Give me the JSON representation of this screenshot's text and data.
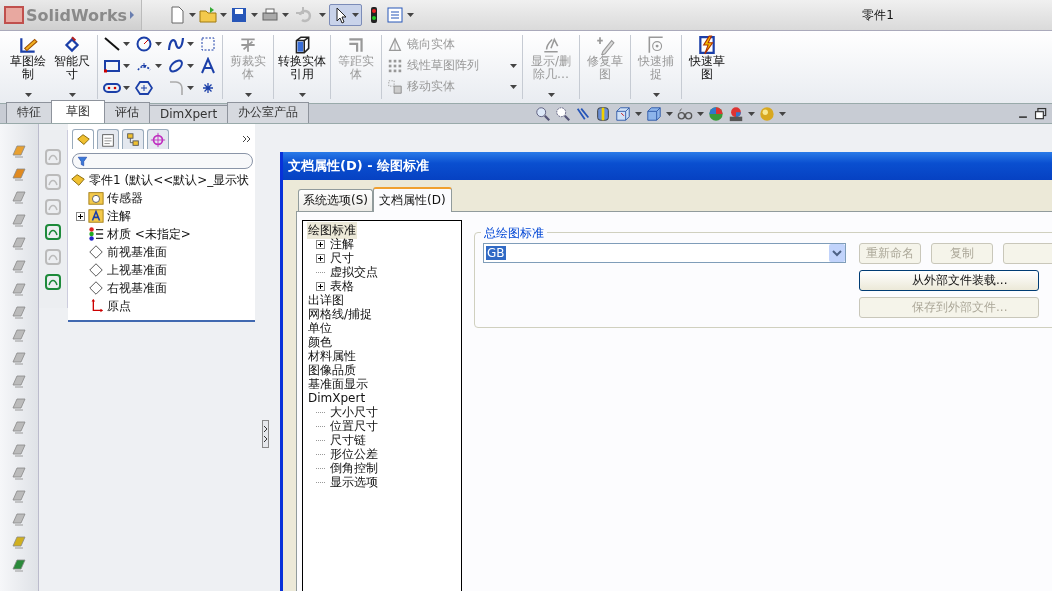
{
  "app": {
    "logo": "SolidWorks",
    "title": "零件1"
  },
  "quick_toolbar": {
    "select_selected": true,
    "undo_disabled": true
  },
  "ribbon": [
    {
      "kind": "large",
      "label": "草图绘制",
      "disabled": false,
      "menu": true
    },
    {
      "kind": "large",
      "label": "智能尺寸",
      "disabled": false,
      "menu": true
    },
    {
      "kind": "tools"
    },
    {
      "kind": "large",
      "label": "剪裁实体",
      "disabled": true,
      "menu": true
    },
    {
      "kind": "large",
      "label": "转换实体引用",
      "disabled": false,
      "menu": true
    },
    {
      "kind": "large",
      "label": "等距实体",
      "disabled": true,
      "menu": false
    },
    {
      "kind": "stack",
      "disabled": true,
      "rows": [
        {
          "label": "镜向实体",
          "menu": false
        },
        {
          "label": "线性草图阵列",
          "menu": true
        },
        {
          "label": "移动实体",
          "menu": true
        }
      ]
    },
    {
      "kind": "large",
      "label": "显示/删除几…",
      "disabled": true,
      "menu": true
    },
    {
      "kind": "large",
      "label": "修复草图",
      "disabled": true,
      "menu": false
    },
    {
      "kind": "large",
      "label": "快速捕捉",
      "disabled": true,
      "menu": true
    },
    {
      "kind": "large",
      "label": "快速草图",
      "disabled": false,
      "menu": false
    }
  ],
  "command_tabs": [
    {
      "label": "特征",
      "selected": false
    },
    {
      "label": "草图",
      "selected": true
    },
    {
      "label": "评估",
      "selected": false
    },
    {
      "label": "DimXpert",
      "selected": false
    },
    {
      "label": "办公室产品",
      "selected": false
    }
  ],
  "feature_tree": {
    "tabs": [
      {
        "selected": true
      },
      {
        "selected": false
      },
      {
        "selected": false
      },
      {
        "selected": false
      }
    ],
    "root": "零件1 (默认<<默认>_显示状",
    "items": [
      {
        "kind": "sensor",
        "label": "传感器"
      },
      {
        "kind": "annotation",
        "label": "注解",
        "expanded": false
      },
      {
        "kind": "material",
        "label": "材质 <未指定>"
      },
      {
        "kind": "plane",
        "label": "前视基准面"
      },
      {
        "kind": "plane",
        "label": "上视基准面"
      },
      {
        "kind": "plane",
        "label": "右视基准面"
      },
      {
        "kind": "origin",
        "label": "原点"
      }
    ]
  },
  "dialog": {
    "title": "文档属性(D) - 绘图标准",
    "tabs": [
      {
        "label": "系统选项(S)",
        "selected": false
      },
      {
        "label": "文档属性(D)",
        "selected": true
      }
    ],
    "tree": [
      {
        "label": "绘图标准",
        "selected": true,
        "children": [
          {
            "label": "注解",
            "selected": false,
            "expanded": false
          },
          {
            "label": "尺寸",
            "selected": false,
            "expanded": false
          },
          {
            "label": "虚拟交点",
            "selected": false
          },
          {
            "label": "表格",
            "selected": false,
            "expanded": false
          }
        ]
      },
      {
        "label": "出详图",
        "selected": false
      },
      {
        "label": "网格线/捕捉",
        "selected": false
      },
      {
        "label": "单位",
        "selected": false
      },
      {
        "label": "颜色",
        "selected": false
      },
      {
        "label": "材料属性",
        "selected": false
      },
      {
        "label": "图像品质",
        "selected": false
      },
      {
        "label": "基准面显示",
        "selected": false
      },
      {
        "label": "DimXpert",
        "selected": false,
        "children": [
          {
            "label": "大小尺寸",
            "selected": false
          },
          {
            "label": "位置尺寸",
            "selected": false
          },
          {
            "label": "尺寸链",
            "selected": false
          },
          {
            "label": "形位公差",
            "selected": false
          },
          {
            "label": "倒角控制",
            "selected": false
          },
          {
            "label": "显示选项",
            "selected": false
          }
        ]
      }
    ],
    "group": {
      "title": "总绘图标准",
      "standard": "GB",
      "buttons": [
        {
          "label": "重新命名",
          "disabled": true
        },
        {
          "label": "复制",
          "disabled": true
        },
        {
          "disabled": true
        }
      ],
      "load": {
        "label": "从外部文件装载...",
        "disabled": false
      },
      "save": {
        "label": "保存到外部文件...",
        "disabled": true
      }
    }
  }
}
